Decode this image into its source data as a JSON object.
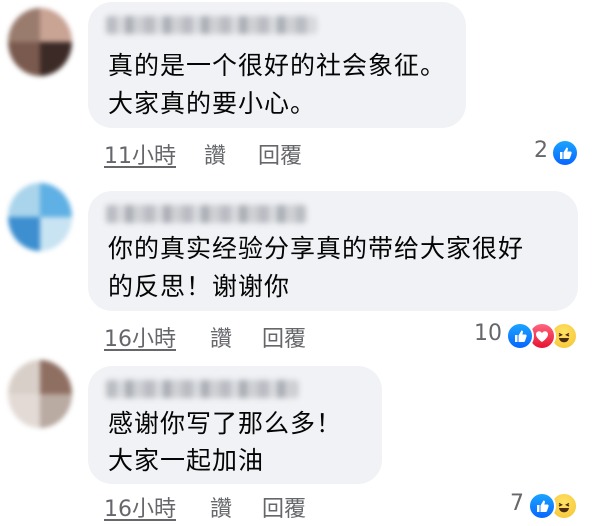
{
  "comments": [
    {
      "lines": [
        "真的是一个很好的社会象征。",
        "大家真的要小心。"
      ],
      "time": "11小時",
      "like_label": "讚",
      "reply_label": "回覆",
      "reaction_count": "2",
      "reactions": [
        "like-icon"
      ],
      "avatar_colors": [
        "#9a7c6e",
        "#c9a394",
        "#3b2a26",
        "#7a5a4e"
      ]
    },
    {
      "lines": [
        "你的真实经验分享真的带给大家很好",
        "的反思！谢谢你"
      ],
      "time": "16小時",
      "like_label": "讚",
      "reply_label": "回覆",
      "reaction_count": "10",
      "reactions": [
        "like-icon",
        "love-icon",
        "haha-icon"
      ],
      "avatar_colors": [
        "#a9d4ec",
        "#5fb0e4",
        "#c8e3f2",
        "#3d8fd0"
      ]
    },
    {
      "lines": [
        "感谢你写了那么多！",
        "大家一起加油"
      ],
      "time": "16小時",
      "like_label": "讚",
      "reply_label": "回覆",
      "reaction_count": "7",
      "reactions": [
        "like-icon",
        "haha-icon"
      ],
      "avatar_colors": [
        "#d9cfc9",
        "#8f6f62",
        "#b9aaa2",
        "#e3dad5"
      ]
    }
  ],
  "colors": {
    "bubble": "#f0f2f5",
    "meta_text": "#65676b",
    "like_blue": "#1877f2",
    "love_red": "#f33e58",
    "haha_yellow": "#f7b125"
  }
}
